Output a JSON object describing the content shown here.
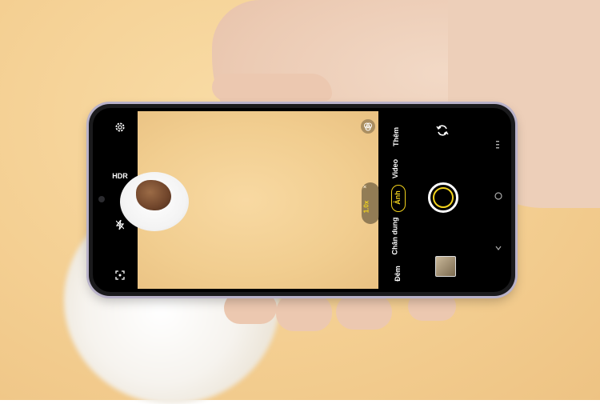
{
  "camera": {
    "top_left_icons": [
      "gear-icon",
      "hdr",
      "flash-off-icon",
      "mode-icon"
    ],
    "hdr_label": "HDR",
    "zoom_label": "1.0x",
    "zoom_top_label": "×",
    "modes": {
      "them": "Thêm",
      "video": "Video",
      "anh": "Ảnh",
      "chan_dung": "Chân dung",
      "dem": "Đêm"
    },
    "active_mode": "Ảnh",
    "icons": {
      "settings": "gear-icon",
      "flash": "flash-off-icon",
      "scene": "scan-icon",
      "filters": "filter-circles-icon",
      "flip": "camera-flip-icon",
      "menu": "hamburger-icon",
      "home": "home-circle-icon",
      "back": "chevron-down-icon",
      "thumbnail": "gallery-thumbnail"
    },
    "colors": {
      "accent_yellow": "#f2d21c",
      "background": "#f4cf92"
    }
  }
}
